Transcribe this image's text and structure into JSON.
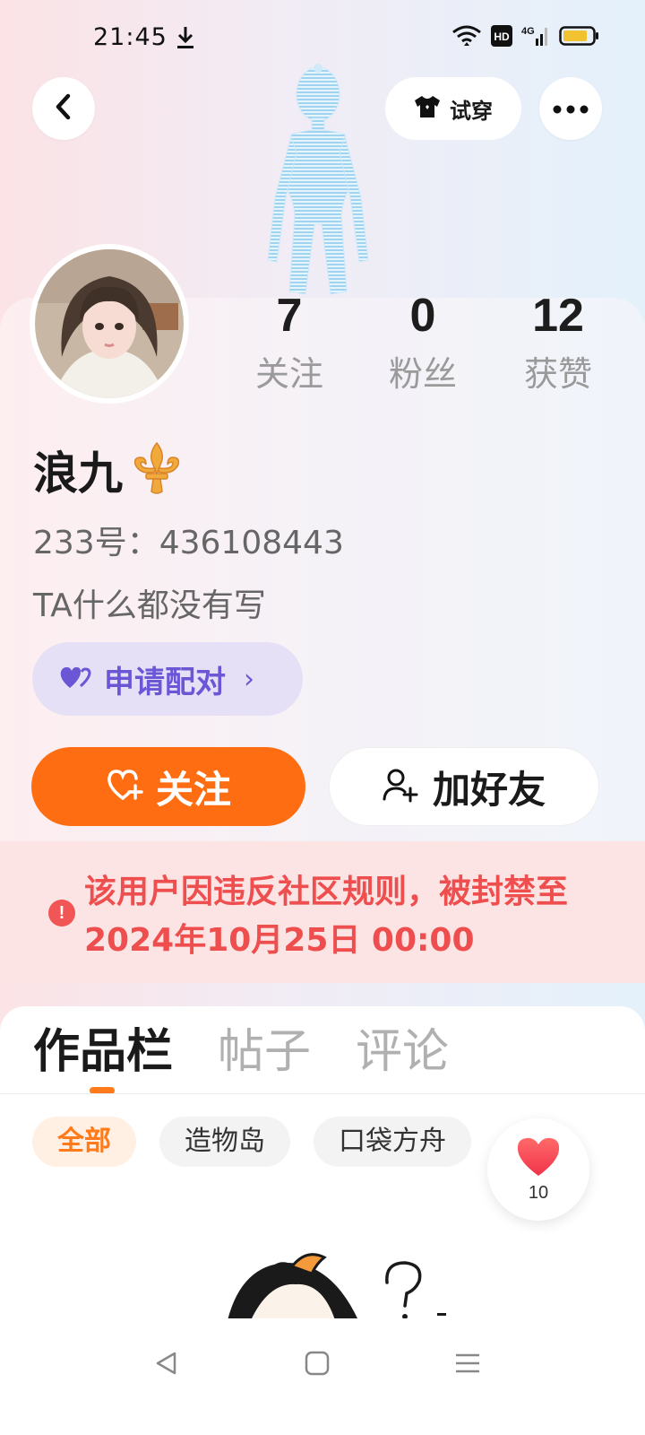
{
  "status_bar": {
    "time": "21:45",
    "network": "4G",
    "hd_badge": "HD",
    "icons": [
      "download-icon",
      "wifi-icon",
      "hd-icon",
      "signal-icon",
      "battery-icon"
    ]
  },
  "header": {
    "back_icon": "chevron-left-icon",
    "tryon_label": "试穿",
    "tryon_icon": "tshirt-icon",
    "more_icon": "more-dots-icon"
  },
  "profile": {
    "stats": [
      {
        "value": "7",
        "label": "关注"
      },
      {
        "value": "0",
        "label": "粉丝"
      },
      {
        "value": "12",
        "label": "获赞"
      }
    ],
    "username": "浪九",
    "badge_icon": "fleur-de-lis-icon",
    "uid_text": "233号：436108443",
    "bio": "TA什么都没有写",
    "pair_button": {
      "label": "申请配对",
      "icon": "hearts-icon",
      "chevron": "›"
    }
  },
  "actions": {
    "follow_label": "关注",
    "follow_icon": "heart-plus-icon",
    "add_friend_label": "加好友",
    "add_friend_icon": "user-plus-icon"
  },
  "ban_notice": {
    "text": "该用户因违反社区规则，被封禁至2024年10月25日 00:00",
    "icon_glyph": "!"
  },
  "content": {
    "tabs": [
      {
        "label": "作品栏",
        "active": true
      },
      {
        "label": "帖子",
        "active": false
      },
      {
        "label": "评论",
        "active": false
      }
    ],
    "chips": [
      {
        "label": "全部",
        "active": true
      },
      {
        "label": "造物岛",
        "active": false
      },
      {
        "label": "口袋方舟",
        "active": false
      }
    ],
    "like_count": "10"
  },
  "colors": {
    "accent": "#ff6d12",
    "pair_purple": "#6b56d6",
    "ban_red": "#ee4e4e",
    "ban_bg": "#fde4e4"
  },
  "nav": {
    "icons": [
      "nav-back-icon",
      "nav-home-icon",
      "nav-menu-icon"
    ]
  }
}
